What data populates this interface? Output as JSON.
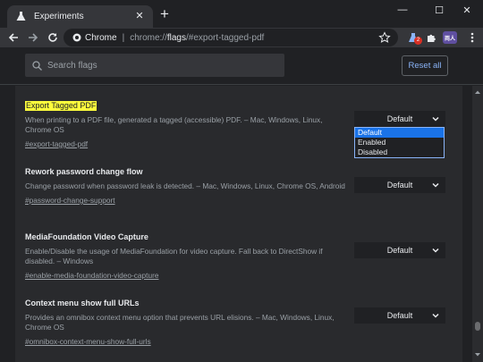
{
  "window": {
    "tab_title": "Experiments",
    "new_tab": "+",
    "controls": {
      "minimize": "—",
      "maximize": "☐",
      "close": "✕"
    }
  },
  "toolbar": {
    "chrome_label": "Chrome",
    "url_scheme": "chrome://",
    "url_host": "flags",
    "url_path": "/#export-tagged-pdf",
    "ext_badge": "2",
    "profile_label": "両人"
  },
  "header": {
    "search_placeholder": "Search flags",
    "reset_label": "Reset all"
  },
  "experiments": [
    {
      "title": "Export Tagged PDF",
      "highlighted": true,
      "desc": "When printing to a PDF file, generated a tagged (accessible) PDF. – Mac, Windows, Linux, Chrome OS",
      "link": "#export-tagged-pdf",
      "value": "Default"
    },
    {
      "title": "Rework password change flow",
      "highlighted": false,
      "desc": "Change password when password leak is detected. – Mac, Windows, Linux, Chrome OS, Android",
      "link": "#password-change-support",
      "value": "Default"
    },
    {
      "title": "MediaFoundation Video Capture",
      "highlighted": false,
      "desc": "Enable/Disable the usage of MediaFoundation for video capture. Fall back to DirectShow if disabled. – Windows",
      "link": "#enable-media-foundation-video-capture",
      "value": "Default"
    },
    {
      "title": "Context menu show full URLs",
      "highlighted": false,
      "desc": "Provides an omnibox context menu option that prevents URL elisions. – Mac, Windows, Linux, Chrome OS",
      "link": "#omnibox-context-menu-show-full-urls",
      "value": "Default"
    }
  ],
  "dropdown_options": [
    "Default",
    "Enabled",
    "Disabled"
  ],
  "dropdown_selected": "Default"
}
